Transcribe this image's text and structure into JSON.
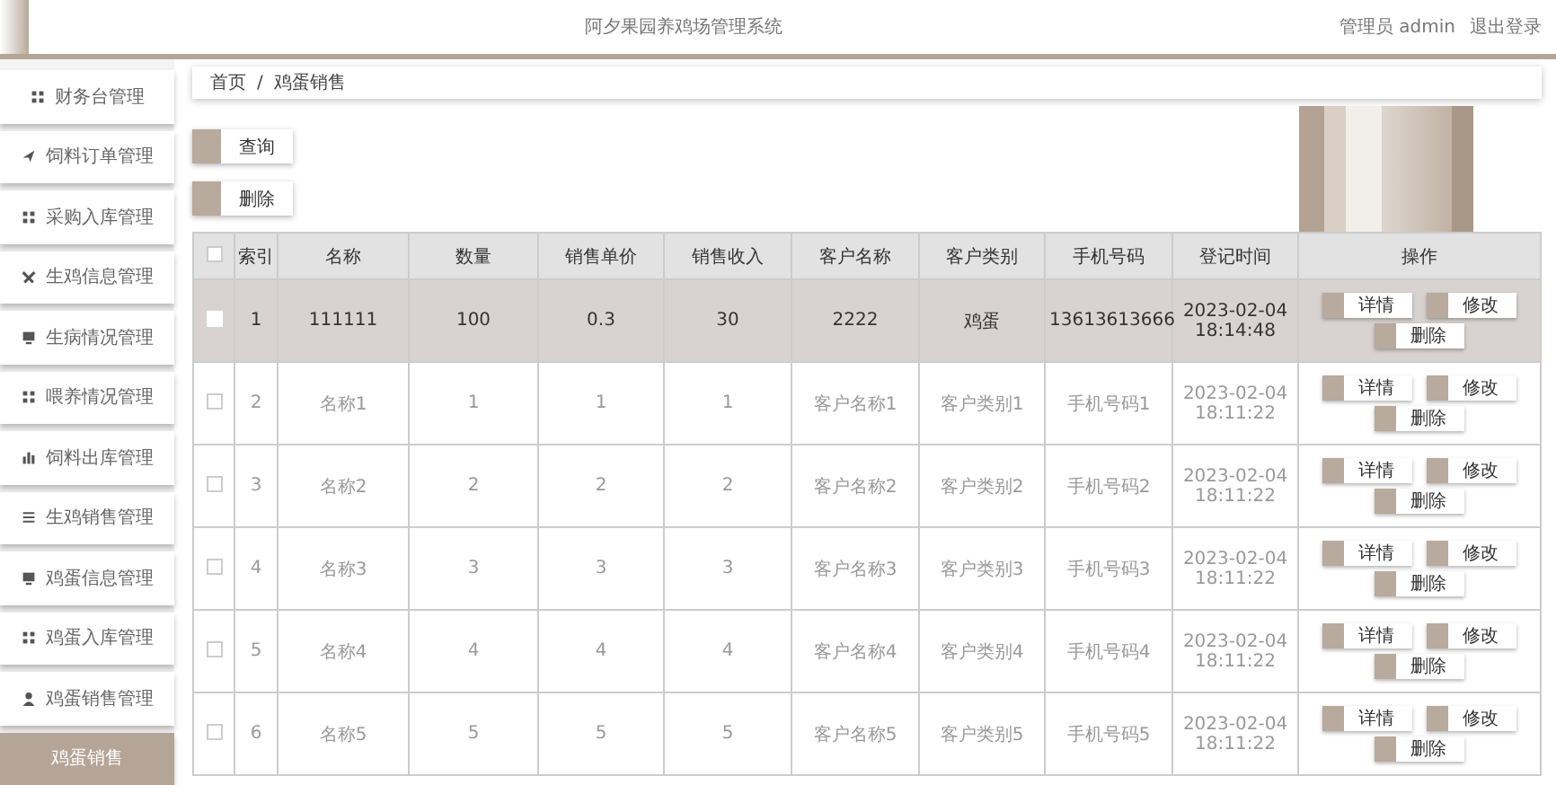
{
  "header": {
    "title": "阿夕果园养鸡场管理系统",
    "user": "管理员 admin",
    "logout": "退出登录"
  },
  "sidebar": {
    "items": [
      {
        "label": "财务台管理",
        "selected": false
      },
      {
        "label": "饲料订单管理",
        "selected": false
      },
      {
        "label": "采购入库管理",
        "selected": false
      },
      {
        "label": "生鸡信息管理",
        "selected": false
      },
      {
        "label": "生病情况管理",
        "selected": false
      },
      {
        "label": "喂养情况管理",
        "selected": false
      },
      {
        "label": "饲料出库管理",
        "selected": false
      },
      {
        "label": "生鸡销售管理",
        "selected": false
      },
      {
        "label": "鸡蛋信息管理",
        "selected": false
      },
      {
        "label": "鸡蛋入库管理",
        "selected": false
      },
      {
        "label": "鸡蛋销售管理",
        "selected": false
      },
      {
        "label": "鸡蛋销售",
        "selected": true
      }
    ]
  },
  "breadcrumb": [
    "首页",
    "/",
    "鸡蛋销售"
  ],
  "actions": [
    "查询",
    "删除"
  ],
  "table": {
    "all_checked": false,
    "columns": [
      "索引",
      "名称",
      "数量",
      "销售单价",
      "销售收入",
      "客户名称",
      "客户类别",
      "手机号码",
      "登记时间",
      "操作"
    ],
    "rows": [
      {
        "highlighted": true,
        "checked": false,
        "cells": [
          "1",
          "111111",
          "100",
          "0.3",
          "30",
          "2222",
          "鸡蛋",
          "13613613666",
          "2023-02-04 18:14:48"
        ],
        "buttons": [
          "详情",
          "修改",
          "删除"
        ]
      },
      {
        "highlighted": false,
        "checked": false,
        "cells": [
          "2",
          "名称1",
          "1",
          "1",
          "1",
          "客户名称1",
          "客户类别1",
          "手机号码1",
          "2023-02-04 18:11:22"
        ],
        "buttons": [
          "详情",
          "修改",
          "删除"
        ]
      },
      {
        "highlighted": false,
        "checked": false,
        "cells": [
          "3",
          "名称2",
          "2",
          "2",
          "2",
          "客户名称2",
          "客户类别2",
          "手机号码2",
          "2023-02-04 18:11:22"
        ],
        "buttons": [
          "详情",
          "修改",
          "删除"
        ]
      },
      {
        "highlighted": false,
        "checked": false,
        "cells": [
          "4",
          "名称3",
          "3",
          "3",
          "3",
          "客户名称3",
          "客户类别3",
          "手机号码3",
          "2023-02-04 18:11:22"
        ],
        "buttons": [
          "详情",
          "修改",
          "删除"
        ]
      },
      {
        "highlighted": false,
        "checked": false,
        "cells": [
          "5",
          "名称4",
          "4",
          "4",
          "4",
          "客户名称4",
          "客户类别4",
          "手机号码4",
          "2023-02-04 18:11:22"
        ],
        "buttons": [
          "详情",
          "修改",
          "删除"
        ]
      },
      {
        "highlighted": false,
        "checked": false,
        "cells": [
          "6",
          "名称5",
          "5",
          "5",
          "5",
          "客户名称5",
          "客户类别5",
          "手机号码5",
          "2023-02-04 18:11:22"
        ],
        "buttons": [
          "详情",
          "修改",
          "删除"
        ]
      }
    ]
  }
}
